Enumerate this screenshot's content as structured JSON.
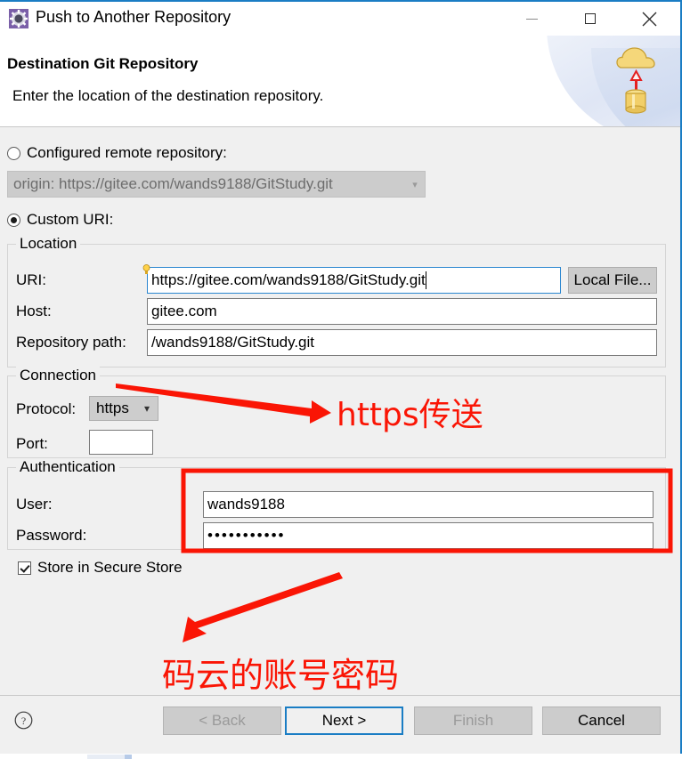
{
  "window": {
    "title": "Push to Another Repository",
    "icon": "gear-icon",
    "minimize_label": "Minimize",
    "maximize_label": "Maximize",
    "close_label": "Close",
    "accent_color": "#1a7dc4"
  },
  "header": {
    "title": "Destination Git Repository",
    "description": "Enter the location of the destination repository.",
    "graphic": "cloud-upload-database-icon"
  },
  "source_selection": {
    "configured_remote": {
      "label": "Configured remote repository:",
      "selected": false
    },
    "remote_combo": {
      "value": "origin: https://gitee.com/wands9188/GitStudy.git",
      "enabled": false,
      "arrow": "chevron-down-icon"
    },
    "custom_uri": {
      "label": "Custom URI:",
      "selected": true
    }
  },
  "location": {
    "group_title": "Location",
    "uri": {
      "label": "URI:",
      "value": "https://gitee.com/wands9188/GitStudy.git",
      "focused": true,
      "assist_icon": "lightbulb-icon"
    },
    "host": {
      "label": "Host:",
      "value": "gitee.com"
    },
    "repository_path": {
      "label": "Repository path:",
      "value": "/wands9188/GitStudy.git"
    },
    "local_file_button": "Local File..."
  },
  "connection": {
    "group_title": "Connection",
    "protocol": {
      "label": "Protocol:",
      "value": "https",
      "arrow": "chevron-down-icon"
    },
    "port": {
      "label": "Port:",
      "value": "",
      "placeholder": ""
    }
  },
  "authentication": {
    "group_title": "Authentication",
    "user": {
      "label": "User:",
      "value": "wands9188"
    },
    "password": {
      "label": "Password:",
      "value": "•••••••••••"
    },
    "store_secure": {
      "label": "Store in Secure Store",
      "checked": true
    }
  },
  "footer": {
    "help_icon": "help-question-icon",
    "back": {
      "label": "< Back",
      "enabled": false
    },
    "next": {
      "label": "Next >",
      "enabled": true,
      "default": true
    },
    "finish": {
      "label": "Finish",
      "enabled": false
    },
    "cancel": {
      "label": "Cancel",
      "enabled": true
    }
  },
  "annotations": {
    "color": "#fa1505",
    "protocol_note": "https传送",
    "credentials_note": "码云的账号密码",
    "highlight_box": "authentication-fields-highlight",
    "arrow_to_protocol": "arrow-right-icon",
    "arrow_to_credentials": "arrow-up-left-icon"
  }
}
